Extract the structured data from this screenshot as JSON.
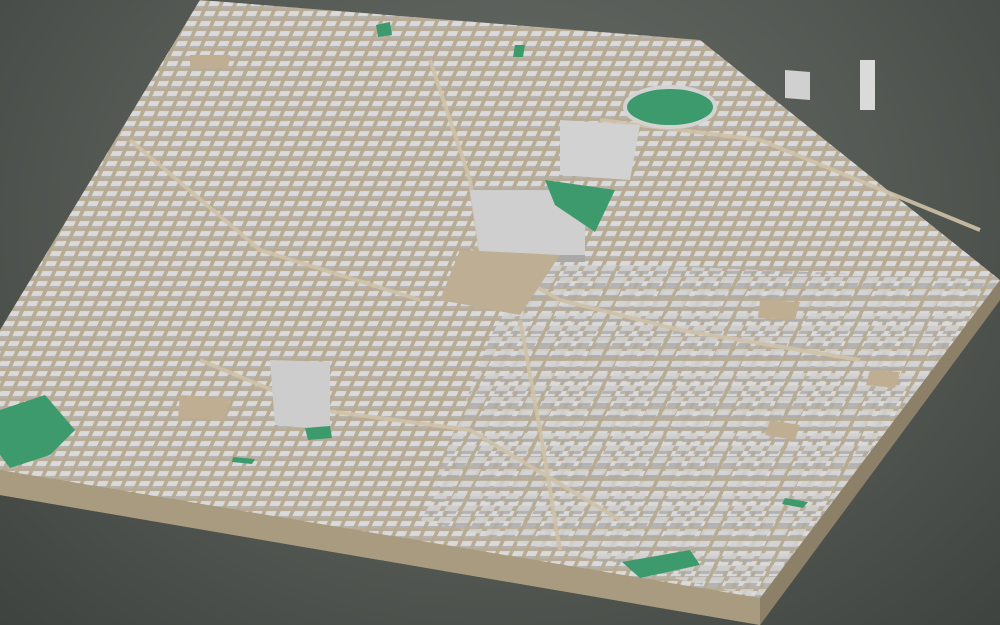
{
  "scene": {
    "kind": "3d-city-block-model",
    "view": "oblique aerial",
    "colors": {
      "background": "#545954",
      "ground": "#b3a692",
      "base_side": "#a09479",
      "building_top": "#d6d6d6",
      "building_side_light": "#c4c4c4",
      "building_side_dark": "#a9a9a9",
      "park": "#3d9a6c",
      "courtyard": "#bfae92"
    },
    "parks": [
      "park-left",
      "park-center",
      "park-roundabout",
      "park-bottom-right",
      "park-small-top",
      "park-small-center"
    ]
  }
}
